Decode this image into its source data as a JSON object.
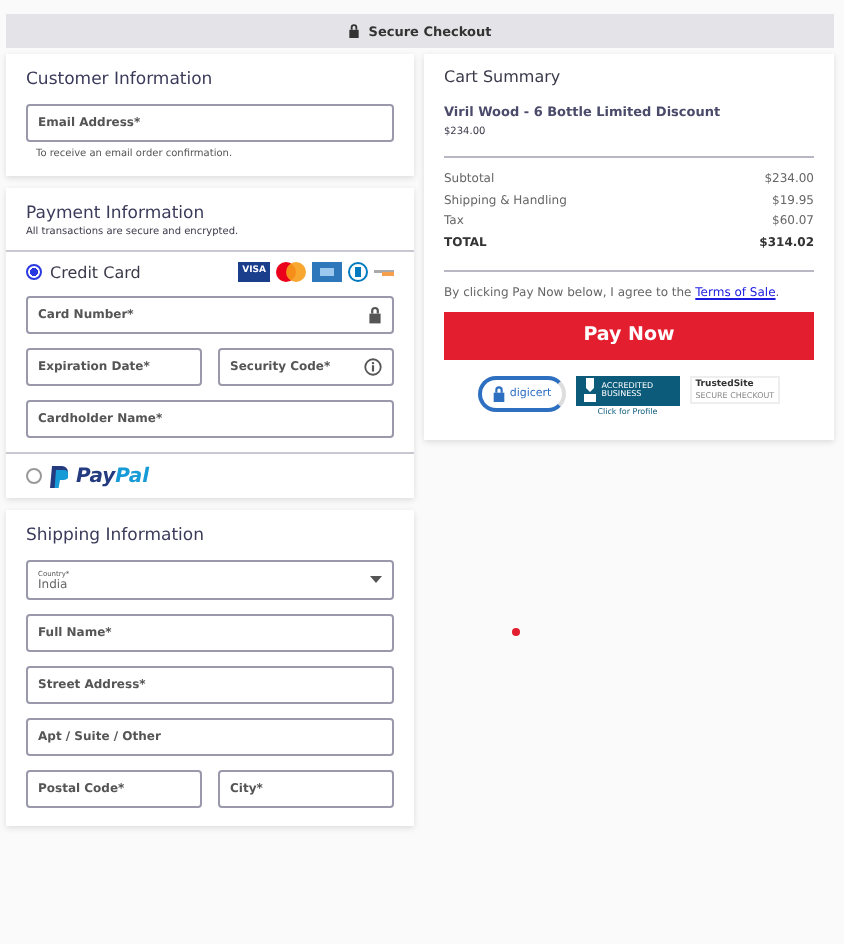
{
  "banner": {
    "text": "Secure Checkout"
  },
  "customer": {
    "title": "Customer Information",
    "fields": [
      {
        "label": "Email Address*"
      }
    ],
    "hint": "To receive an email order confirmation."
  },
  "payment": {
    "title": "Payment Information",
    "subtitle": "All transactions are secure and encrypted.",
    "methods": [
      {
        "kind": "card",
        "label": "Credit Card",
        "selected": true,
        "card_logo_text": "VISA"
      },
      {
        "kind": "paypal",
        "label_a": "Pay",
        "label_b": "Pal",
        "selected": false
      }
    ],
    "card_fields": [
      {
        "label": "Card Number*",
        "kind": "secure"
      },
      {
        "label": "Expiration Date*",
        "kind": "plain"
      },
      {
        "label": "Security Code*",
        "kind": "help"
      },
      {
        "label": "Cardholder Name*",
        "kind": "plain"
      }
    ]
  },
  "shipping": {
    "title": "Shipping Information",
    "country": {
      "label": "Country*",
      "value": "India"
    },
    "fields": [
      {
        "label": "Full Name*",
        "half": false
      },
      {
        "label": "Street Address*",
        "half": false
      },
      {
        "label": "Apt / Suite / Other",
        "half": false
      },
      {
        "label": "Postal Code*",
        "half": true
      },
      {
        "label": "City*",
        "half": true
      }
    ]
  },
  "cart": {
    "title": "Cart Summary",
    "product": "Viril Wood - 6 Bottle Limited Discount",
    "product_price": "$234.00",
    "lines": [
      {
        "label": "Subtotal",
        "value": "$234.00",
        "total": false
      },
      {
        "label": "Shipping & Handling",
        "value": "$19.95",
        "total": false
      },
      {
        "label": "Tax",
        "value": "$60.07",
        "total": false
      },
      {
        "label": "TOTAL",
        "value": "$314.02",
        "total": true
      }
    ],
    "agree": "By clicking Pay Now below, I agree to the ",
    "terms_link": "Terms of Sale",
    "agree_end": ".",
    "button": "Pay Now",
    "badges": {
      "digicert": "digicert",
      "bbb": "ACCREDITED BUSINESS",
      "bbb_sub": "Click for Profile",
      "trusted": "TrustedSite",
      "trusted_sub": "SECURE CHECKOUT"
    }
  }
}
